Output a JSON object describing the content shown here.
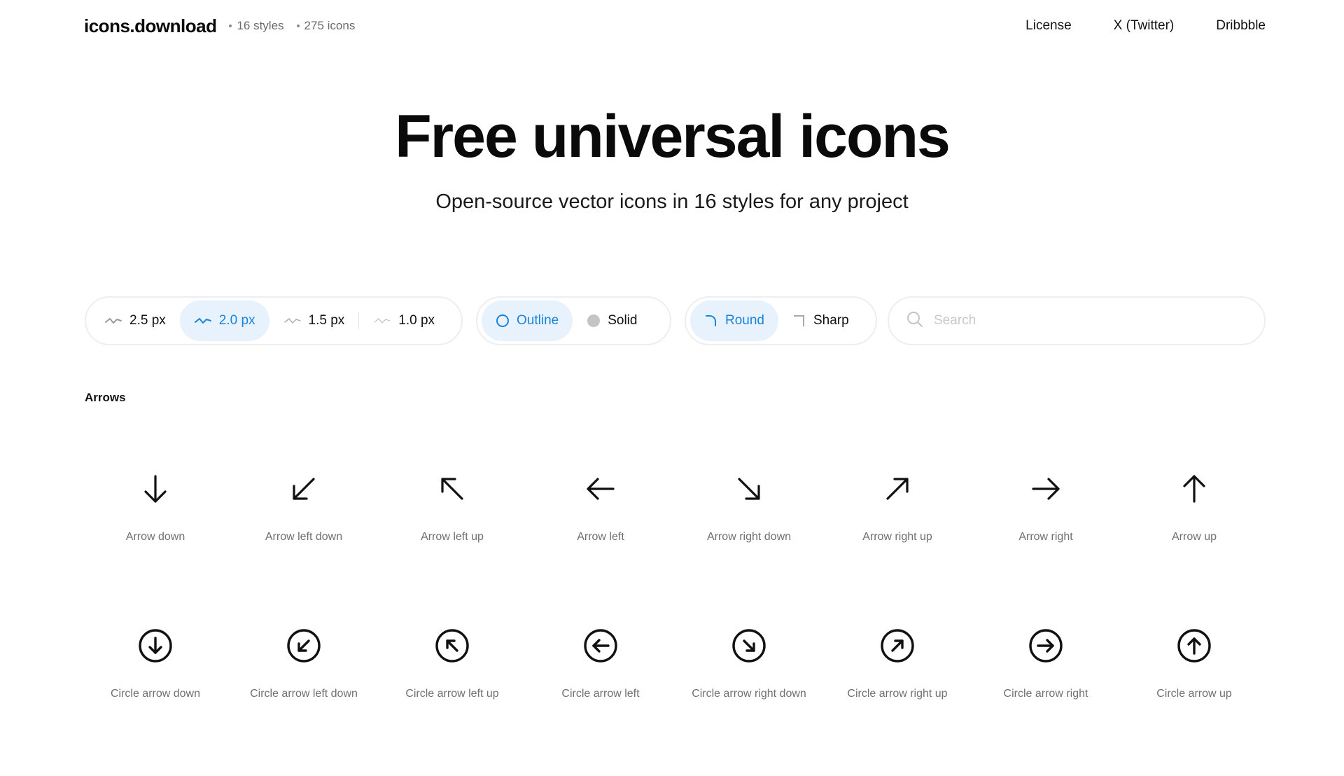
{
  "header": {
    "brand": "icons.download",
    "styles_count": "16 styles",
    "icons_count": "275 icons",
    "nav": [
      "License",
      "X (Twitter)",
      "Dribbble"
    ]
  },
  "hero": {
    "title": "Free universal icons",
    "subtitle": "Open-source vector icons in 16 styles for any project"
  },
  "controls": {
    "stroke_options": [
      "2.5 px",
      "2.0 px",
      "1.5 px",
      "1.0 px"
    ],
    "stroke_selected": "2.0 px",
    "fill_options": [
      "Outline",
      "Solid"
    ],
    "fill_selected": "Outline",
    "corner_options": [
      "Round",
      "Sharp"
    ],
    "corner_selected": "Round",
    "search_placeholder": "Search"
  },
  "colors": {
    "accent": "#1a84dc",
    "accent_bg": "#e7f2fd",
    "muted_text": "#707070"
  },
  "section": {
    "title": "Arrows",
    "icons": [
      {
        "label": "Arrow down",
        "icon": "arrow-down-icon"
      },
      {
        "label": "Arrow left down",
        "icon": "arrow-left-down-icon"
      },
      {
        "label": "Arrow left up",
        "icon": "arrow-left-up-icon"
      },
      {
        "label": "Arrow left",
        "icon": "arrow-left-icon"
      },
      {
        "label": "Arrow right down",
        "icon": "arrow-right-down-icon"
      },
      {
        "label": "Arrow right up",
        "icon": "arrow-right-up-icon"
      },
      {
        "label": "Arrow right",
        "icon": "arrow-right-icon"
      },
      {
        "label": "Arrow up",
        "icon": "arrow-up-icon"
      },
      {
        "label": "Circle arrow down",
        "icon": "circle-arrow-down-icon"
      },
      {
        "label": "Circle arrow left down",
        "icon": "circle-arrow-left-down-icon"
      },
      {
        "label": "Circle arrow left up",
        "icon": "circle-arrow-left-up-icon"
      },
      {
        "label": "Circle arrow left",
        "icon": "circle-arrow-left-icon"
      },
      {
        "label": "Circle arrow right down",
        "icon": "circle-arrow-right-down-icon"
      },
      {
        "label": "Circle arrow right up",
        "icon": "circle-arrow-right-up-icon"
      },
      {
        "label": "Circle arrow right",
        "icon": "circle-arrow-right-icon"
      },
      {
        "label": "Circle arrow up",
        "icon": "circle-arrow-up-icon"
      }
    ]
  }
}
